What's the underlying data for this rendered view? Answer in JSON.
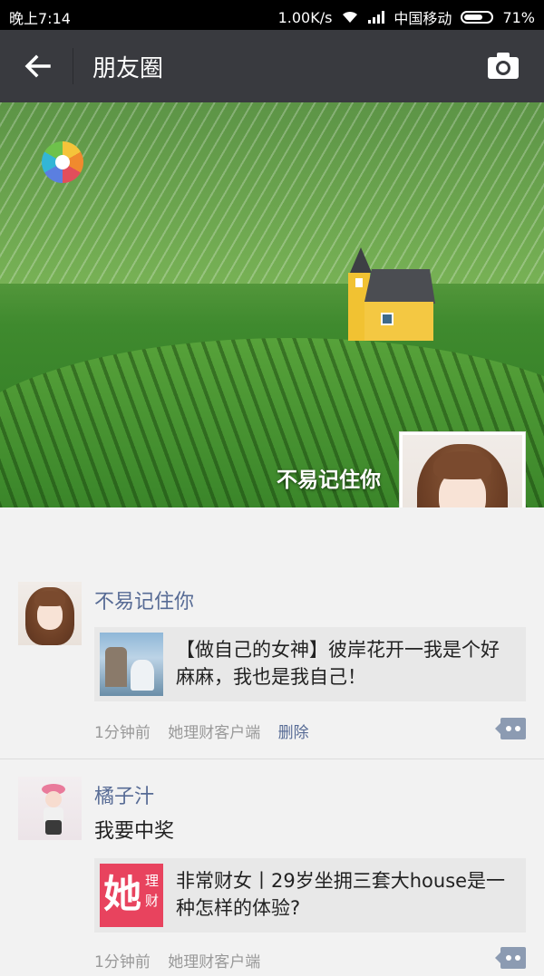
{
  "status": {
    "time": "晚上7:14",
    "speed": "1.00K/s",
    "carrier": "中国移动",
    "battery": "71%",
    "battery_level": 0.71
  },
  "header": {
    "title": "朋友圈"
  },
  "cover": {
    "owner_name": "不易记住你"
  },
  "posts": [
    {
      "name": "不易记住你",
      "text": "",
      "card_text": "【做自己的女神】彼岸花开一我是个好麻麻，我也是我自己！",
      "time": "1分钟前",
      "source": "她理财客户端",
      "delete": "删除"
    },
    {
      "name": "橘子汁",
      "text": "我要中奖",
      "card_thumb_big": "她",
      "card_thumb_small": "理财",
      "card_text": "非常财女丨29岁坐拥三套大house是一种怎样的体验?",
      "time": "1分钟前",
      "source": "她理财客户端"
    }
  ],
  "colors": {
    "titlebar": "#393a3f",
    "link": "#576b95",
    "accent_pink": "#e8435e"
  }
}
